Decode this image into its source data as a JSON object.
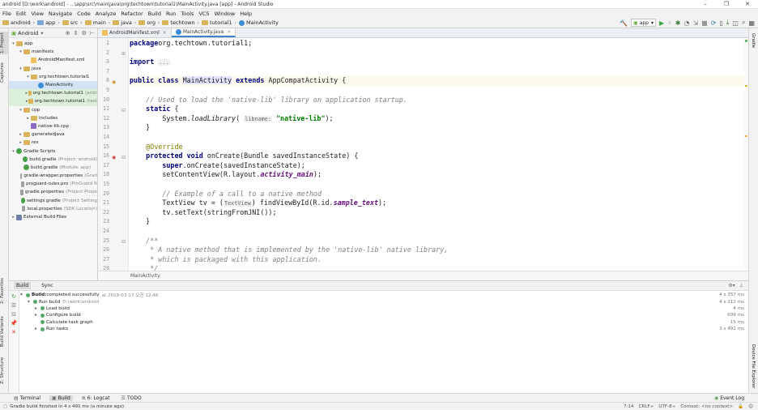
{
  "window": {
    "title": "android [D:\\work\\android] - ...\\app\\src\\main\\java\\org\\techtown\\tutorial1\\MainActivity.java [app] - Android Studio",
    "min": "–",
    "max": "❐",
    "close": "✕"
  },
  "menu": [
    "File",
    "Edit",
    "View",
    "Navigate",
    "Code",
    "Analyze",
    "Refactor",
    "Build",
    "Run",
    "Tools",
    "VCS",
    "Window",
    "Help"
  ],
  "breadcrumb": [
    "android",
    "app",
    "src",
    "main",
    "java",
    "org",
    "techtown",
    "tutorial1",
    "MainActivity"
  ],
  "run_config": "app",
  "project_panel": {
    "view_label": "Android"
  },
  "left_tabs": [
    "1: Project",
    "Captures",
    "2: Favorites",
    "Build Variants",
    "Z: Structure"
  ],
  "right_tabs": [
    "Gradle",
    "Device File Explorer"
  ],
  "tree": [
    {
      "indent": 0,
      "arrow": "▾",
      "icon": "folder",
      "label": "app",
      "muted": ""
    },
    {
      "indent": 1,
      "arrow": "▾",
      "icon": "folder",
      "label": "manifests",
      "muted": ""
    },
    {
      "indent": 2,
      "arrow": "",
      "icon": "xml",
      "label": "AndroidManifest.xml",
      "muted": ""
    },
    {
      "indent": 1,
      "arrow": "▾",
      "icon": "folder",
      "label": "java",
      "muted": ""
    },
    {
      "indent": 2,
      "arrow": "▾",
      "icon": "folder",
      "label": "org.techtown.tutorial1",
      "muted": ""
    },
    {
      "indent": 3,
      "arrow": "",
      "icon": "java",
      "label": "MainActivity",
      "muted": "",
      "selected": true
    },
    {
      "indent": 2,
      "arrow": "▸",
      "icon": "folder",
      "label": "org.techtown.tutorial1",
      "muted": "(andr",
      "hl": true
    },
    {
      "indent": 2,
      "arrow": "▸",
      "icon": "folder",
      "label": "org.techtown.tutorial1",
      "muted": "(test",
      "hl": true
    },
    {
      "indent": 1,
      "arrow": "▾",
      "icon": "folder",
      "label": "cpp",
      "muted": ""
    },
    {
      "indent": 2,
      "arrow": "▸",
      "icon": "folder",
      "label": "includes",
      "muted": ""
    },
    {
      "indent": 2,
      "arrow": "",
      "icon": "cpp",
      "label": "native-lib.cpp",
      "muted": ""
    },
    {
      "indent": 1,
      "arrow": "▸",
      "icon": "folder",
      "label": "generatedJava",
      "muted": ""
    },
    {
      "indent": 1,
      "arrow": "▸",
      "icon": "folder",
      "label": "res",
      "muted": ""
    },
    {
      "indent": 0,
      "arrow": "▾",
      "icon": "gradle",
      "label": "Gradle Scripts",
      "muted": ""
    },
    {
      "indent": 1,
      "arrow": "",
      "icon": "gradle",
      "label": "build.gradle",
      "muted": "(Project: android)"
    },
    {
      "indent": 1,
      "arrow": "",
      "icon": "gradle",
      "label": "build.gradle",
      "muted": "(Module: app)"
    },
    {
      "indent": 1,
      "arrow": "",
      "icon": "prop",
      "label": "gradle-wrapper.properties",
      "muted": "(Grad"
    },
    {
      "indent": 1,
      "arrow": "",
      "icon": "prop",
      "label": "proguard-rules.pro",
      "muted": "(ProGuard R"
    },
    {
      "indent": 1,
      "arrow": "",
      "icon": "prop",
      "label": "gradle.properties",
      "muted": "(Project Prope"
    },
    {
      "indent": 1,
      "arrow": "",
      "icon": "gradle",
      "label": "settings.gradle",
      "muted": "(Project Setting"
    },
    {
      "indent": 1,
      "arrow": "",
      "icon": "prop",
      "label": "local.properties",
      "muted": "(SDK Location)"
    },
    {
      "indent": 0,
      "arrow": "▸",
      "icon": "libs",
      "label": "External Build Files",
      "muted": ""
    }
  ],
  "editor_tabs": [
    {
      "label": "AndroidManifest.xml",
      "active": false
    },
    {
      "label": "MainActivity.java",
      "active": true
    }
  ],
  "code": {
    "line_numbers": [
      "1",
      "2",
      "3",
      "7",
      "8",
      "9",
      "10",
      "11",
      "12",
      "13",
      "14",
      "15",
      "16",
      "17",
      "18",
      "19",
      "20",
      "21",
      "22",
      "23",
      "24",
      "25",
      "26"
    ],
    "lines": [
      {
        "n": "1",
        "segs": [
          [
            "k",
            "package"
          ],
          [
            "",
            "org.techtown.tutorial1;"
          ]
        ]
      },
      {
        "n": "2",
        "segs": []
      },
      {
        "n": "3",
        "segs": [
          [
            "k",
            "import"
          ],
          [
            "",
            " "
          ],
          [
            "fold",
            "..."
          ]
        ]
      },
      {
        "n": "7",
        "segs": [],
        "blank": true
      },
      {
        "n": "8",
        "segs": [
          [
            "k",
            "public class"
          ],
          [
            "",
            " "
          ],
          [
            "sel",
            "MainActivity"
          ],
          [
            "",
            " "
          ],
          [
            "k",
            "extends"
          ],
          [
            "",
            " AppCompatActivity {"
          ]
        ],
        "cur": true
      },
      {
        "n": "9",
        "segs": []
      },
      {
        "n": "10",
        "segs": [
          [
            "",
            "    "
          ],
          [
            "cm",
            "// Used to load the 'native-lib' library on application startup."
          ]
        ]
      },
      {
        "n": "11",
        "segs": [
          [
            "",
            "    "
          ],
          [
            "k",
            "static"
          ],
          [
            "",
            " {"
          ]
        ]
      },
      {
        "n": "12",
        "segs": [
          [
            "",
            "        System."
          ],
          [
            "it",
            "loadLibrary"
          ],
          [
            "",
            "( "
          ],
          [
            "hint",
            "libname:"
          ],
          [
            "",
            " "
          ],
          [
            "st",
            "\"native-lib\""
          ],
          [
            "",
            ");"
          ]
        ]
      },
      {
        "n": "13",
        "segs": [
          [
            "",
            "    }"
          ]
        ]
      },
      {
        "n": "14",
        "segs": []
      },
      {
        "n": "15",
        "segs": [
          [
            "",
            "    "
          ],
          [
            "an",
            "@Override"
          ]
        ]
      },
      {
        "n": "16",
        "segs": [
          [
            "",
            "    "
          ],
          [
            "k",
            "protected void"
          ],
          [
            "",
            " onCreate(Bundle savedInstanceState) {"
          ]
        ]
      },
      {
        "n": "17",
        "segs": [
          [
            "",
            "        "
          ],
          [
            "k",
            "super"
          ],
          [
            "",
            ".onCreate(savedInstanceState);"
          ]
        ]
      },
      {
        "n": "18",
        "segs": [
          [
            "",
            "        setContentView(R.layout."
          ],
          [
            "fld",
            "activity_main"
          ],
          [
            "",
            ");"
          ]
        ]
      },
      {
        "n": "19",
        "segs": []
      },
      {
        "n": "20",
        "segs": [
          [
            "",
            "        "
          ],
          [
            "cm",
            "// Example of a call to a native method"
          ]
        ]
      },
      {
        "n": "21",
        "segs": [
          [
            "",
            "        TextView tv = ("
          ],
          [
            "hint",
            "TextView"
          ],
          [
            "",
            ") findViewById(R.id."
          ],
          [
            "fld",
            "sample_text"
          ],
          [
            "",
            ");"
          ]
        ]
      },
      {
        "n": "22",
        "segs": [
          [
            "",
            "        tv.setText(stringFromJNI());"
          ]
        ]
      },
      {
        "n": "23",
        "segs": [
          [
            "",
            "    }"
          ]
        ]
      },
      {
        "n": "24",
        "segs": []
      },
      {
        "n": "25",
        "segs": [
          [
            "",
            "    "
          ],
          [
            "cm",
            "/**"
          ]
        ]
      },
      {
        "n": "26",
        "segs": [
          [
            "",
            "     "
          ],
          [
            "cm",
            "* A native method that is implemented by the 'native-lib' native library,"
          ]
        ]
      },
      {
        "n": "27",
        "segs": [
          [
            "",
            "     "
          ],
          [
            "cm",
            "* which is packaged with this application."
          ]
        ]
      },
      {
        "n": "28",
        "segs": [
          [
            "",
            "     "
          ],
          [
            "cm",
            "*/"
          ]
        ]
      }
    ]
  },
  "editor_breadcrumb": "MainActivity",
  "build_panel": {
    "tabs": [
      "Build",
      "Sync"
    ],
    "rows": [
      {
        "indent": 0,
        "arrow": "▾",
        "label": "Build:",
        "label2": " completed successfully",
        "extra": "at 2019-03-17 오전 12:46",
        "time": "4 s 357 ms"
      },
      {
        "indent": 1,
        "arrow": "▾",
        "label": "Run build",
        "label2": "",
        "extra": "D:\\work\\android",
        "time": "4 s 212 ms"
      },
      {
        "indent": 2,
        "arrow": "▸",
        "label": "Load build",
        "label2": "",
        "extra": "",
        "time": "4 ms"
      },
      {
        "indent": 2,
        "arrow": "▸",
        "label": "Configure build",
        "label2": "",
        "extra": "",
        "time": "699 ms"
      },
      {
        "indent": 2,
        "arrow": "",
        "label": "Calculate task graph",
        "label2": "",
        "extra": "",
        "time": "15 ms"
      },
      {
        "indent": 2,
        "arrow": "▸",
        "label": "Run tasks",
        "label2": "",
        "extra": "",
        "time": "3 s 492 ms"
      }
    ]
  },
  "bottom_tabs": [
    {
      "label": "Terminal",
      "active": false
    },
    {
      "label": "Build",
      "active": true
    },
    {
      "label": "6: Logcat",
      "active": false
    },
    {
      "label": "TODO",
      "active": false
    }
  ],
  "event_log": "Event Log",
  "status": {
    "message": "Gradle build finished in 4 s 491 ms (a minute ago)",
    "position": "7:14",
    "line_sep": "CRLF÷",
    "encoding": "UTF-8÷",
    "context": "Context: <no context>"
  }
}
